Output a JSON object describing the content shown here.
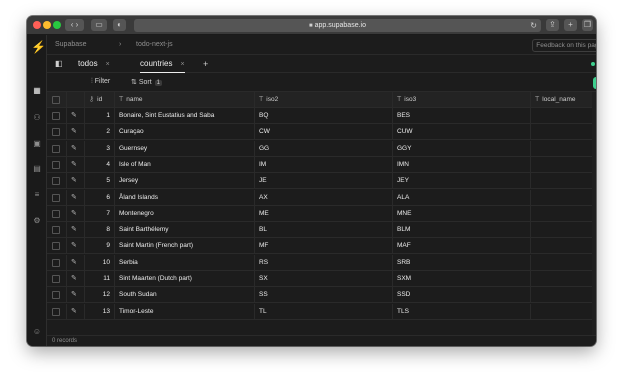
{
  "browser": {
    "url": "app.supabase.io",
    "reload_icon": "reload-icon",
    "lock_icon": "lock-icon"
  },
  "breadcrumbs": [
    "Supabase",
    "todo-next-js"
  ],
  "feedback_label": "Feedback on this page?",
  "tabs": [
    {
      "label": "todos",
      "active": false
    },
    {
      "label": "countries",
      "active": true
    }
  ],
  "toolbar": {
    "filter_label": "Filter",
    "sort_label": "Sort",
    "sort_count": "1",
    "add_label": "+"
  },
  "columns": [
    "id",
    "name",
    "iso2",
    "iso3",
    "local_name"
  ],
  "rows": [
    {
      "id": "1",
      "name": "Bonaire, Sint Eustatius and Saba",
      "iso2": "BQ",
      "iso3": "BES"
    },
    {
      "id": "2",
      "name": "Curaçao",
      "iso2": "CW",
      "iso3": "CUW"
    },
    {
      "id": "3",
      "name": "Guernsey",
      "iso2": "GG",
      "iso3": "GGY"
    },
    {
      "id": "4",
      "name": "Isle of Man",
      "iso2": "IM",
      "iso3": "IMN"
    },
    {
      "id": "5",
      "name": "Jersey",
      "iso2": "JE",
      "iso3": "JEY"
    },
    {
      "id": "6",
      "name": "Åland Islands",
      "iso2": "AX",
      "iso3": "ALA"
    },
    {
      "id": "7",
      "name": "Montenegro",
      "iso2": "ME",
      "iso3": "MNE"
    },
    {
      "id": "8",
      "name": "Saint Barthélemy",
      "iso2": "BL",
      "iso3": "BLM"
    },
    {
      "id": "9",
      "name": "Saint Martin (French part)",
      "iso2": "MF",
      "iso3": "MAF"
    },
    {
      "id": "10",
      "name": "Serbia",
      "iso2": "RS",
      "iso3": "SRB"
    },
    {
      "id": "11",
      "name": "Sint Maarten (Dutch part)",
      "iso2": "SX",
      "iso3": "SXM"
    },
    {
      "id": "12",
      "name": "South Sudan",
      "iso2": "SS",
      "iso3": "SSD"
    },
    {
      "id": "13",
      "name": "Timor-Leste",
      "iso2": "TL",
      "iso3": "TLS"
    }
  ],
  "footer": {
    "records_label": "0 records"
  },
  "colors": {
    "accent": "#3ecf8e",
    "background": "#1c1c1c"
  }
}
